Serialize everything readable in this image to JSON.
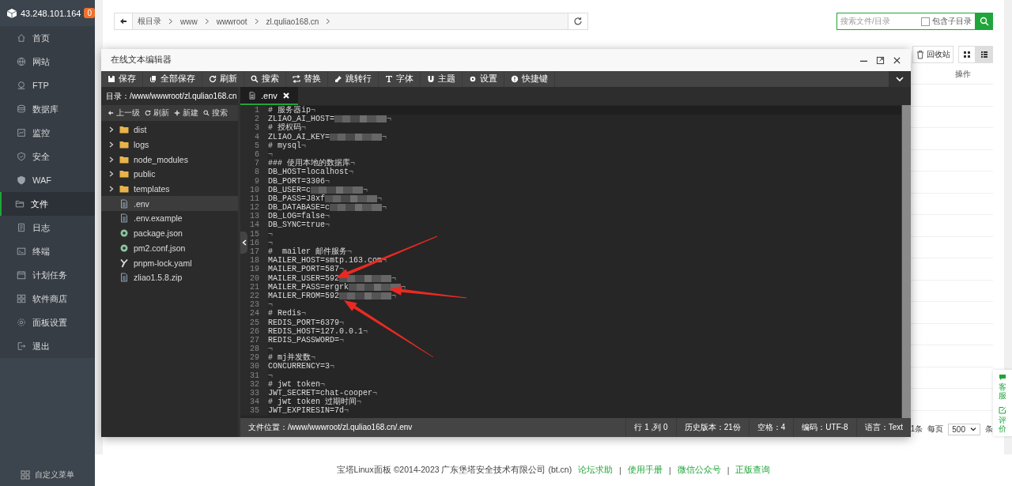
{
  "sidebar": {
    "host": "43.248.101.164",
    "badge": "0",
    "items": [
      {
        "label": "首页",
        "selected": false
      },
      {
        "label": "网站",
        "selected": false
      },
      {
        "label": "FTP",
        "selected": false
      },
      {
        "label": "数据库",
        "selected": false
      },
      {
        "label": "监控",
        "selected": false
      },
      {
        "label": "安全",
        "selected": false
      },
      {
        "label": "WAF",
        "selected": false
      },
      {
        "label": "文件",
        "selected": true
      },
      {
        "label": "日志",
        "selected": false
      },
      {
        "label": "终端",
        "selected": false
      },
      {
        "label": "计划任务",
        "selected": false
      },
      {
        "label": "软件商店",
        "selected": false
      },
      {
        "label": "面板设置",
        "selected": false
      },
      {
        "label": "退出",
        "selected": false
      }
    ],
    "footer": "自定义菜单"
  },
  "path_bar": {
    "crumbs": [
      "根目录",
      "www",
      "wwwroot",
      "zl.quliao168.cn"
    ]
  },
  "search": {
    "placeholder": "搜索文件/目录",
    "include_subdirs": {
      "label": "包含子目录",
      "checked": false
    }
  },
  "toolbar": {
    "recycle_button": "回收站",
    "views": [
      {
        "kind": "grid",
        "selected": false
      },
      {
        "kind": "list",
        "selected": true
      }
    ]
  },
  "table": {
    "action_header": "操作"
  },
  "pagination": {
    "total": "1条",
    "per_page_label": "每页",
    "per_page": "500",
    "unit": "条"
  },
  "float_widget": [
    {
      "label": "客服"
    },
    {
      "label": "评价"
    }
  ],
  "footer": {
    "copyright": "宝塔Linux面板 ©2014-2023 广东堡塔安全技术有限公司 (bt.cn)",
    "separator": "|",
    "links": [
      "论坛求助",
      "使用手册",
      "微信公众号",
      "正版查询"
    ]
  },
  "editor": {
    "title": "在线文本编辑器",
    "tools": [
      "保存",
      "全部保存",
      "刷新",
      "搜索",
      "替换",
      "跳转行",
      "字体",
      "主题",
      "设置",
      "快捷键"
    ],
    "directory": "目录：/www/wwwroot/zl.quliao168.cn",
    "actions": [
      "上一级",
      "刷新",
      "新建",
      "搜索"
    ],
    "files": [
      {
        "name": "dist",
        "kind": "folder",
        "selected": false
      },
      {
        "name": "logs",
        "kind": "folder",
        "selected": false
      },
      {
        "name": "node_modules",
        "kind": "folder",
        "selected": false
      },
      {
        "name": "public",
        "kind": "folder",
        "selected": false
      },
      {
        "name": "templates",
        "kind": "folder",
        "selected": false
      },
      {
        "name": ".env",
        "kind": "text",
        "selected": true
      },
      {
        "name": ".env.example",
        "kind": "text",
        "selected": false
      },
      {
        "name": "package.json",
        "kind": "json",
        "selected": false
      },
      {
        "name": "pm2.conf.json",
        "kind": "json",
        "selected": false
      },
      {
        "name": "pnpm-lock.yaml",
        "kind": "yaml",
        "selected": false
      },
      {
        "name": "zliao1.5.8.zip",
        "kind": "zip",
        "selected": false
      }
    ],
    "tab": {
      "label": ".env"
    },
    "eol_mark": "¬",
    "lines": [
      {
        "number": "1",
        "text": "# 服务器ip",
        "redacted": false
      },
      {
        "number": "2",
        "text": "ZLIAO_AI_HOST=",
        "redacted": true
      },
      {
        "number": "3",
        "text": "# 授权码",
        "redacted": false
      },
      {
        "number": "4",
        "text": "ZLIAO_AI_KEY=",
        "redacted": true
      },
      {
        "number": "5",
        "text": "# mysql",
        "redacted": false
      },
      {
        "number": "6",
        "redacted": false
      },
      {
        "number": "7",
        "text": "### 使用本地的数据库",
        "redacted": false
      },
      {
        "number": "8",
        "text": "DB_HOST=localhost",
        "redacted": false
      },
      {
        "number": "9",
        "text": "DB_PORT=3306",
        "redacted": false
      },
      {
        "number": "10",
        "text": "DB_USER=c",
        "redacted": true
      },
      {
        "number": "11",
        "text": "DB_PASS=J8xf",
        "redacted": true
      },
      {
        "number": "12",
        "text": "DB_DATABASE=c",
        "redacted": true
      },
      {
        "number": "13",
        "text": "DB_LOG=false",
        "redacted": false
      },
      {
        "number": "14",
        "text": "DB_SYNC=true",
        "redacted": false
      },
      {
        "number": "15",
        "redacted": false
      },
      {
        "number": "16",
        "redacted": false
      },
      {
        "number": "17",
        "text": "#  mailer 邮件服务",
        "redacted": false
      },
      {
        "number": "18",
        "text": "MAILER_HOST=smtp.163.com",
        "redacted": false
      },
      {
        "number": "19",
        "text": "MAILER_PORT=587",
        "redacted": false
      },
      {
        "number": "20",
        "text": "MAILER_USER=592",
        "redacted": true
      },
      {
        "number": "21",
        "text": "MAILER_PASS=ergrk",
        "redacted": true
      },
      {
        "number": "22",
        "text": "MAILER_FROM=592",
        "redacted": true
      },
      {
        "number": "23",
        "redacted": false
      },
      {
        "number": "24",
        "text": "# Redis",
        "redacted": false
      },
      {
        "number": "25",
        "text": "REDIS_PORT=6379",
        "redacted": false
      },
      {
        "number": "26",
        "text": "REDIS_HOST=127.0.0.1",
        "redacted": false
      },
      {
        "number": "27",
        "text": "REDIS_PASSWORD=",
        "redacted": false
      },
      {
        "number": "28",
        "redacted": false
      },
      {
        "number": "29",
        "text": "# mj并发数",
        "redacted": false
      },
      {
        "number": "30",
        "text": "CONCURRENCY=3",
        "redacted": false
      },
      {
        "number": "31",
        "redacted": false
      },
      {
        "number": "32",
        "text": "# jwt token",
        "redacted": false
      },
      {
        "number": "33",
        "text": "JWT_SECRET=chat-cooper",
        "redacted": false
      },
      {
        "number": "34",
        "text": "# jwt token 过期时间",
        "redacted": false
      },
      {
        "number": "35",
        "text": "JWT_EXPIRESIN=7d",
        "redacted": false
      }
    ],
    "status": {
      "location": "文件位置：/www/wwwroot/zl.quliao168.cn/.env",
      "items": [
        "行 1 ,列 0",
        "历史版本：21份",
        "空格：4",
        "编码：UTF-8",
        "语言：Text"
      ]
    }
  },
  "annotations": [
    {
      "kind": "arrow"
    },
    {
      "kind": "arrow"
    },
    {
      "kind": "arrow"
    }
  ]
}
